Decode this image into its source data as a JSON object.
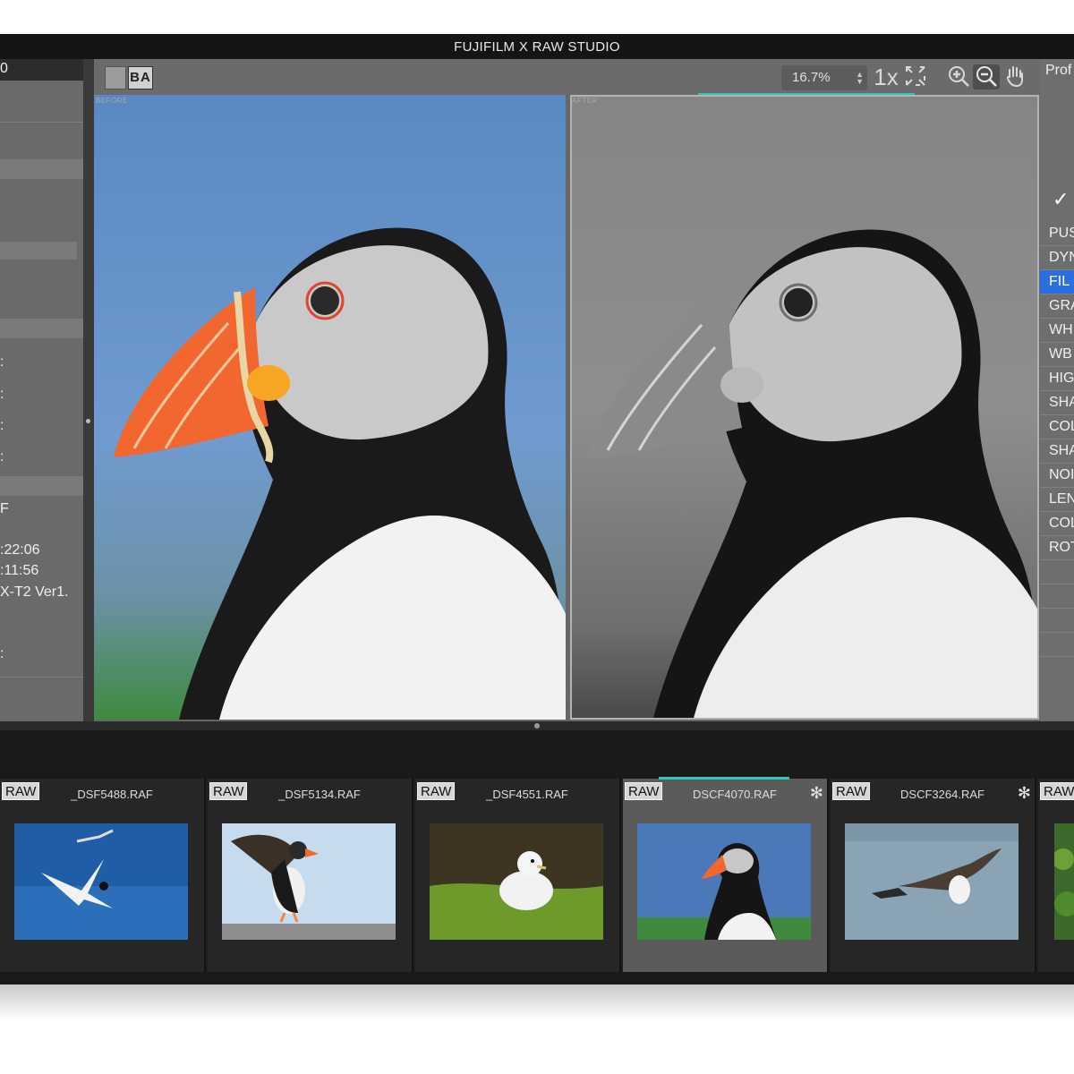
{
  "window": {
    "title": "FUJIFILM X RAW STUDIO"
  },
  "left_panel": {
    "header": "0",
    "rows": [
      ":",
      ":",
      ":",
      ":"
    ],
    "file_ext": "F",
    "time1": ":22:06",
    "time2": ":11:56",
    "camera": "X-T2 Ver1.",
    "extra": ":"
  },
  "toolbar": {
    "ba_label": "BA",
    "zoom_value": "16.7%",
    "one_x_label": "1x"
  },
  "viewer": {
    "before_label": "BEFORE",
    "after_label": "AFTER",
    "progress": 1.0
  },
  "right_panel": {
    "title": "Prof",
    "items": [
      {
        "label": "PUS",
        "active": false
      },
      {
        "label": "DYN",
        "active": false
      },
      {
        "label": "FIL",
        "active": true
      },
      {
        "label": "GRA",
        "active": false
      },
      {
        "label": "WH",
        "active": false
      },
      {
        "label": "WB",
        "active": false
      },
      {
        "label": "HIG",
        "active": false
      },
      {
        "label": "SHA",
        "active": false
      },
      {
        "label": "COL",
        "active": false
      },
      {
        "label": "SHA",
        "active": false
      },
      {
        "label": "NOI",
        "active": false
      },
      {
        "label": "LEN",
        "active": false
      },
      {
        "label": "COL",
        "active": false
      },
      {
        "label": "ROT",
        "active": false
      }
    ]
  },
  "filmstrip": {
    "raw_label": "RAW",
    "thumbs": [
      {
        "name": "_DSF5488.RAF",
        "selected": false,
        "starred": false
      },
      {
        "name": "_DSF5134.RAF",
        "selected": false,
        "starred": false
      },
      {
        "name": "_DSF4551.RAF",
        "selected": false,
        "starred": false
      },
      {
        "name": "DSCF4070.RAF",
        "selected": true,
        "starred": true
      },
      {
        "name": "DSCF3264.RAF",
        "selected": false,
        "starred": true
      },
      {
        "name": "",
        "selected": false,
        "starred": false
      }
    ]
  },
  "icons": {
    "zoom_in": "zoom-in-icon",
    "zoom_out": "zoom-out-icon",
    "hand": "hand-icon",
    "fit": "fit-screen-icon",
    "star": "asterisk-icon",
    "check": "check-icon"
  },
  "colors": {
    "accent": "#2ec9b4",
    "active_item": "#2b6ee0"
  }
}
